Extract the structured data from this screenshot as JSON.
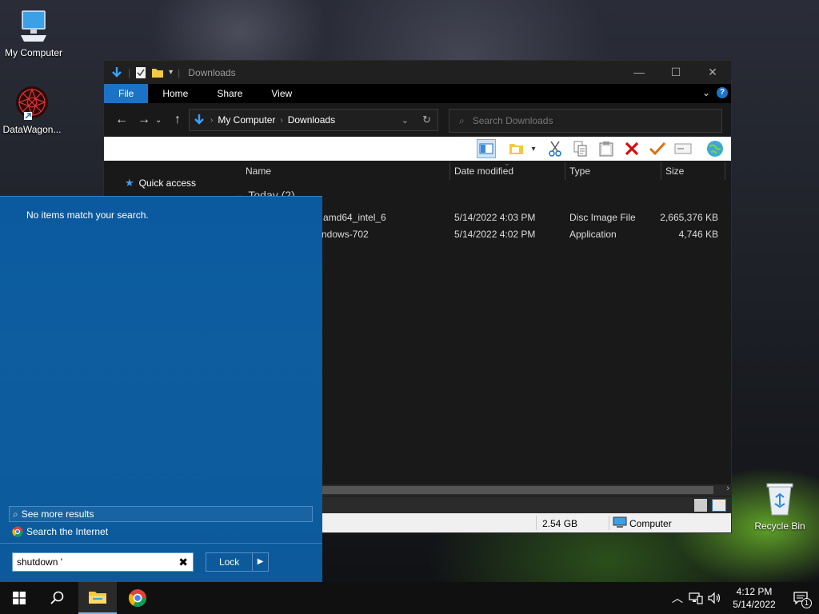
{
  "desktop": {
    "icons": [
      {
        "label": "My Computer"
      },
      {
        "label": "DataWagon..."
      },
      {
        "label": "Recycle Bin"
      }
    ]
  },
  "explorer": {
    "title": "Downloads",
    "ribbon_tabs": [
      "File",
      "Home",
      "Share",
      "View"
    ],
    "breadcrumb": [
      "My Computer",
      "Downloads"
    ],
    "search_placeholder": "Search Downloads",
    "nav_pane": {
      "quick_access": "Quick access"
    },
    "columns": [
      "Name",
      "Date modified",
      "Type",
      "Size"
    ],
    "group_header": "Today (2)",
    "files": [
      {
        "name": "amd64_intel_6",
        "date": "5/14/2022 4:03 PM",
        "type": "Disc Image File",
        "size": "2,665,376 KB"
      },
      {
        "name": "ndows-702",
        "date": "5/14/2022 4:02 PM",
        "type": "Application",
        "size": "4,746 KB"
      }
    ],
    "status": {
      "free_space": "2.54 GB",
      "location": "Computer"
    }
  },
  "start_search": {
    "no_match": "No items match your search.",
    "see_more": "See more results",
    "search_internet": "Search the Internet",
    "query": "shutdown '",
    "lock_label": "Lock"
  },
  "taskbar": {
    "time": "4:12 PM",
    "date": "5/14/2022",
    "notification_count": "1"
  },
  "colors": {
    "start_panel": "#0c5a9c",
    "file_tab": "#1a73c7",
    "window_bg": "#191919"
  }
}
